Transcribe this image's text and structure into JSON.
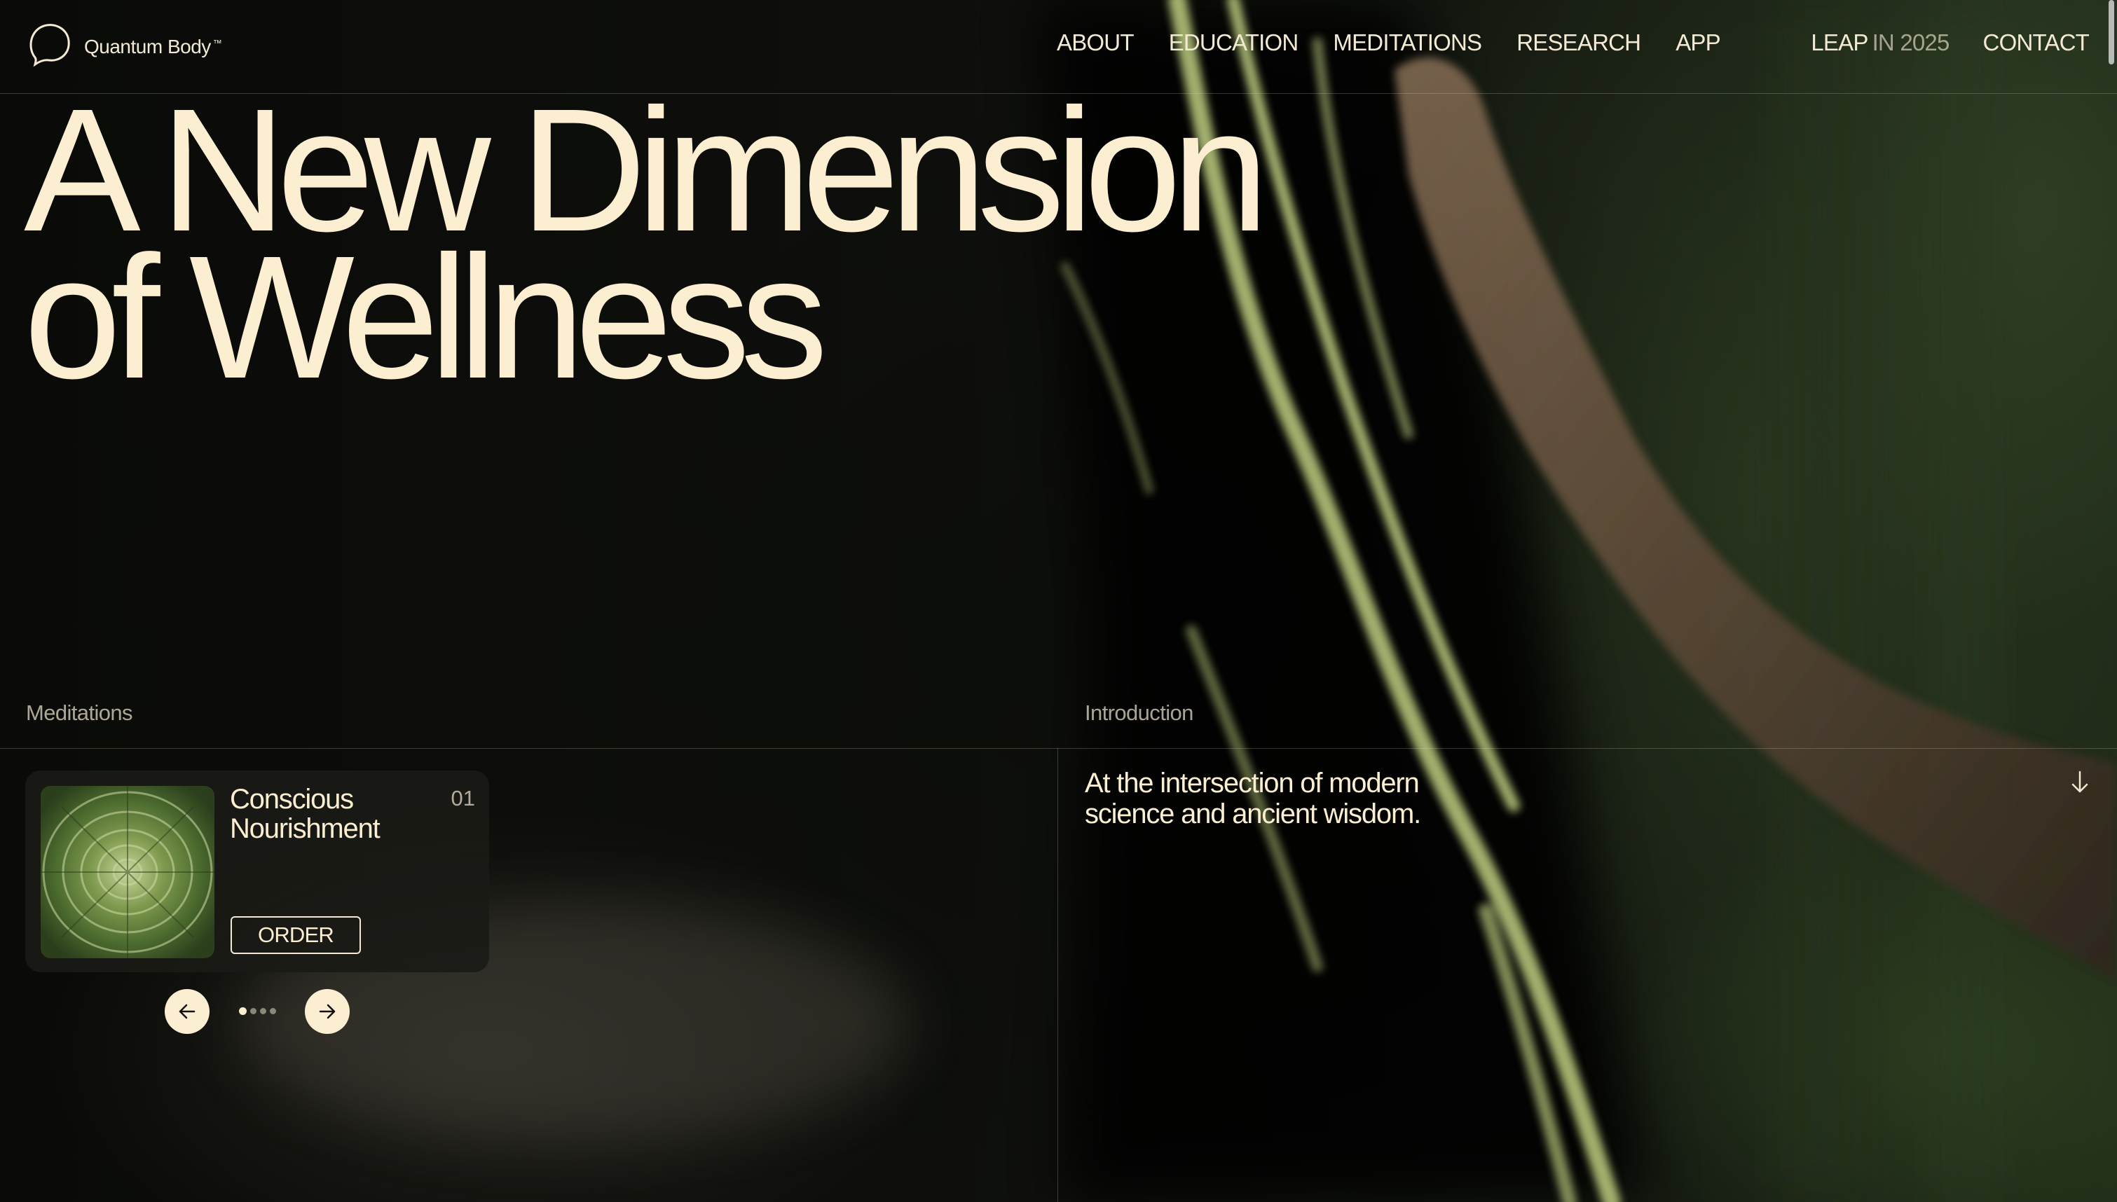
{
  "brand": {
    "name": "Quantum Body",
    "trademark": "™"
  },
  "nav": {
    "items": [
      {
        "label": "ABOUT"
      },
      {
        "label": "EDUCATION"
      },
      {
        "label": "MEDITATIONS"
      },
      {
        "label": "RESEARCH"
      },
      {
        "label": "APP"
      }
    ],
    "leap": {
      "label": "LEAP",
      "year": "IN 2025"
    },
    "contact": "CONTACT"
  },
  "hero": {
    "headline_line1": "A New Dimension",
    "headline_line2": "of Wellness",
    "image_icon": "hand-on-mossy-tree-photo"
  },
  "meditations": {
    "section_label": "Meditations",
    "card": {
      "title_line1": "Conscious",
      "title_line2": "Nourishment",
      "number": "01",
      "button": "ORDER",
      "image_icon": "succulent-rosette-image"
    },
    "carousel": {
      "prev_icon": "arrow-left-icon",
      "next_icon": "arrow-right-icon",
      "total_slides": 4,
      "active_slide": 1
    }
  },
  "introduction": {
    "section_label": "Introduction",
    "text_line1": "At the intersection of modern",
    "text_line2": "science and ancient wisdom.",
    "scroll_icon": "arrow-down-icon"
  },
  "colors": {
    "cream": "#fbeed1",
    "background": "#0b0c09",
    "moss": "#a8b86a"
  }
}
